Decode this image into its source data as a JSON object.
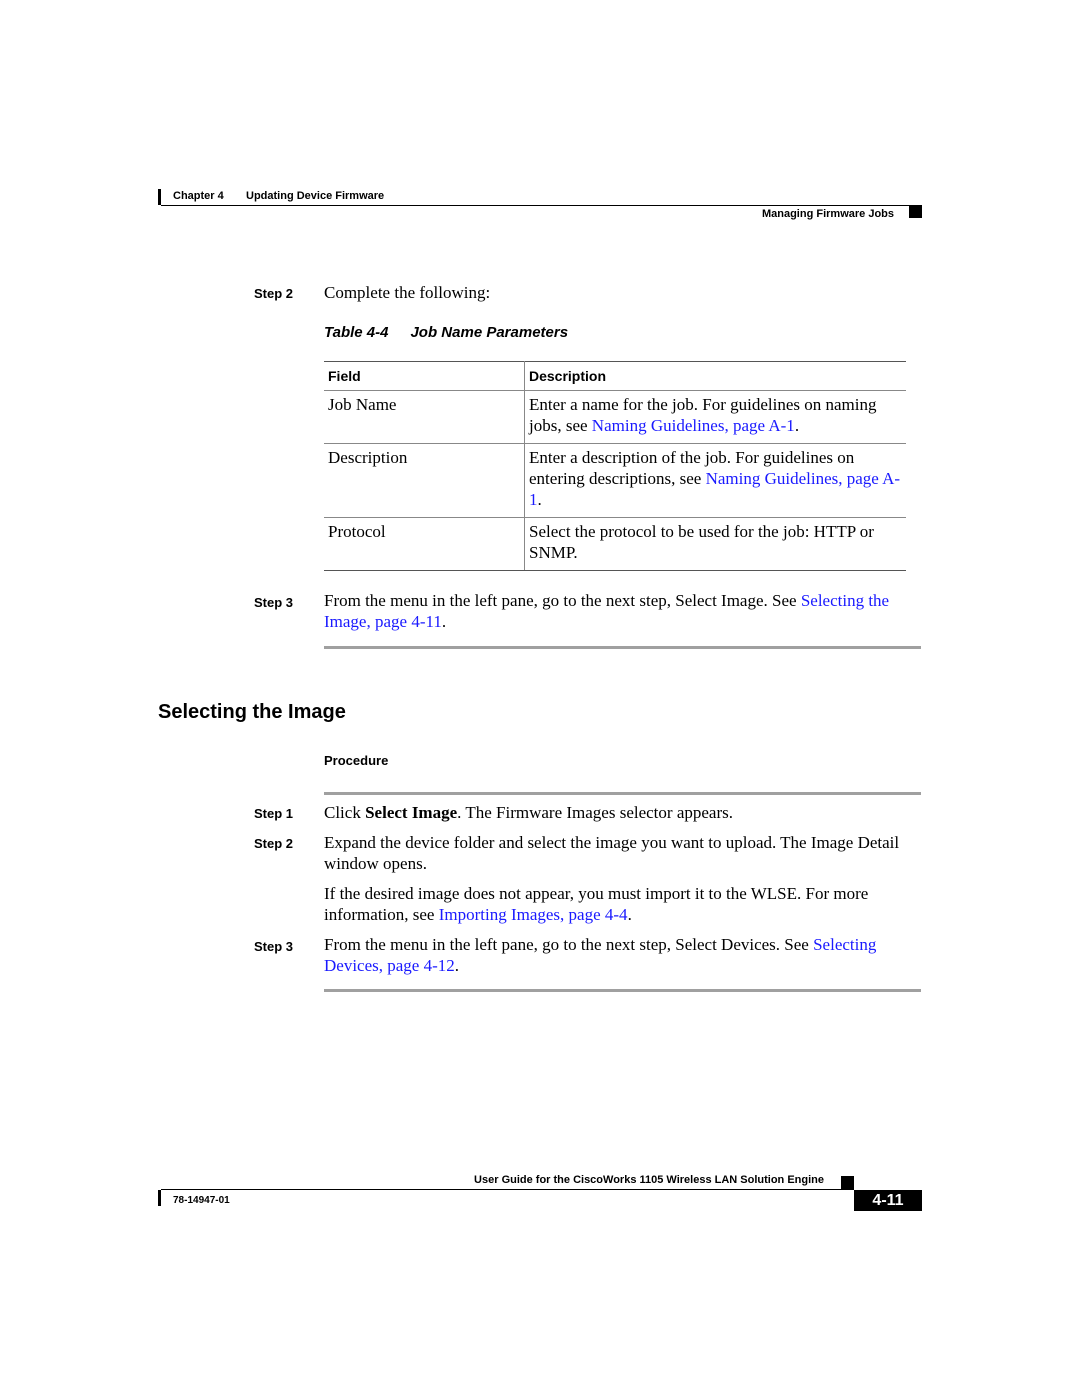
{
  "header": {
    "chapter": "Chapter 4",
    "chapter_title": "Updating Device Firmware",
    "section": "Managing Firmware Jobs"
  },
  "step2": {
    "label": "Step 2",
    "text": "Complete the following:"
  },
  "table": {
    "caption_number": "Table 4-4",
    "caption_title": "Job Name Parameters",
    "headers": [
      "Field",
      "Description"
    ],
    "rows": [
      {
        "field": "Job Name",
        "desc_pre": "Enter a name for the job. For guidelines on naming jobs, see ",
        "desc_link": "Naming Guidelines, page A-1",
        "desc_post": "."
      },
      {
        "field": "Description",
        "desc_pre": "Enter a description of the job. For guidelines on entering descriptions, see ",
        "desc_link": "Naming Guidelines, page A-1",
        "desc_post": "."
      },
      {
        "field": "Protocol",
        "desc_pre": "Select the protocol to be used for the job: HTTP or SNMP.",
        "desc_link": "",
        "desc_post": ""
      }
    ]
  },
  "step3": {
    "label": "Step 3",
    "text_pre": "From the menu in the left pane, go to the next step, Select Image. See ",
    "link": "Selecting the Image, page 4-11",
    "text_post": "."
  },
  "section": {
    "heading": "Selecting the Image",
    "procedure_label": "Procedure",
    "steps": [
      {
        "label": "Step 1",
        "pre": "Click ",
        "bold": "Select Image",
        "post": ". The Firmware Images selector appears."
      },
      {
        "label": "Step 2",
        "text": "Expand the device folder and select the image you want to upload. The Image Detail window opens.",
        "note_pre": "If the desired image does not appear, you must import it to the WLSE. For more information, see ",
        "note_link": "Importing Images, page 4-4",
        "note_post": "."
      },
      {
        "label": "Step 3",
        "pre": "From the menu in the left pane, go to the next step, Select Devices. See ",
        "link": "Selecting Devices, page 4-12",
        "post": "."
      }
    ]
  },
  "footer": {
    "guide_title": "User Guide for the CiscoWorks 1105 Wireless LAN Solution Engine",
    "doc_number": "78-14947-01",
    "page_number": "4-11"
  },
  "colors": {
    "link": "#1a1aff",
    "rule_gray": "#a0a0a0"
  }
}
